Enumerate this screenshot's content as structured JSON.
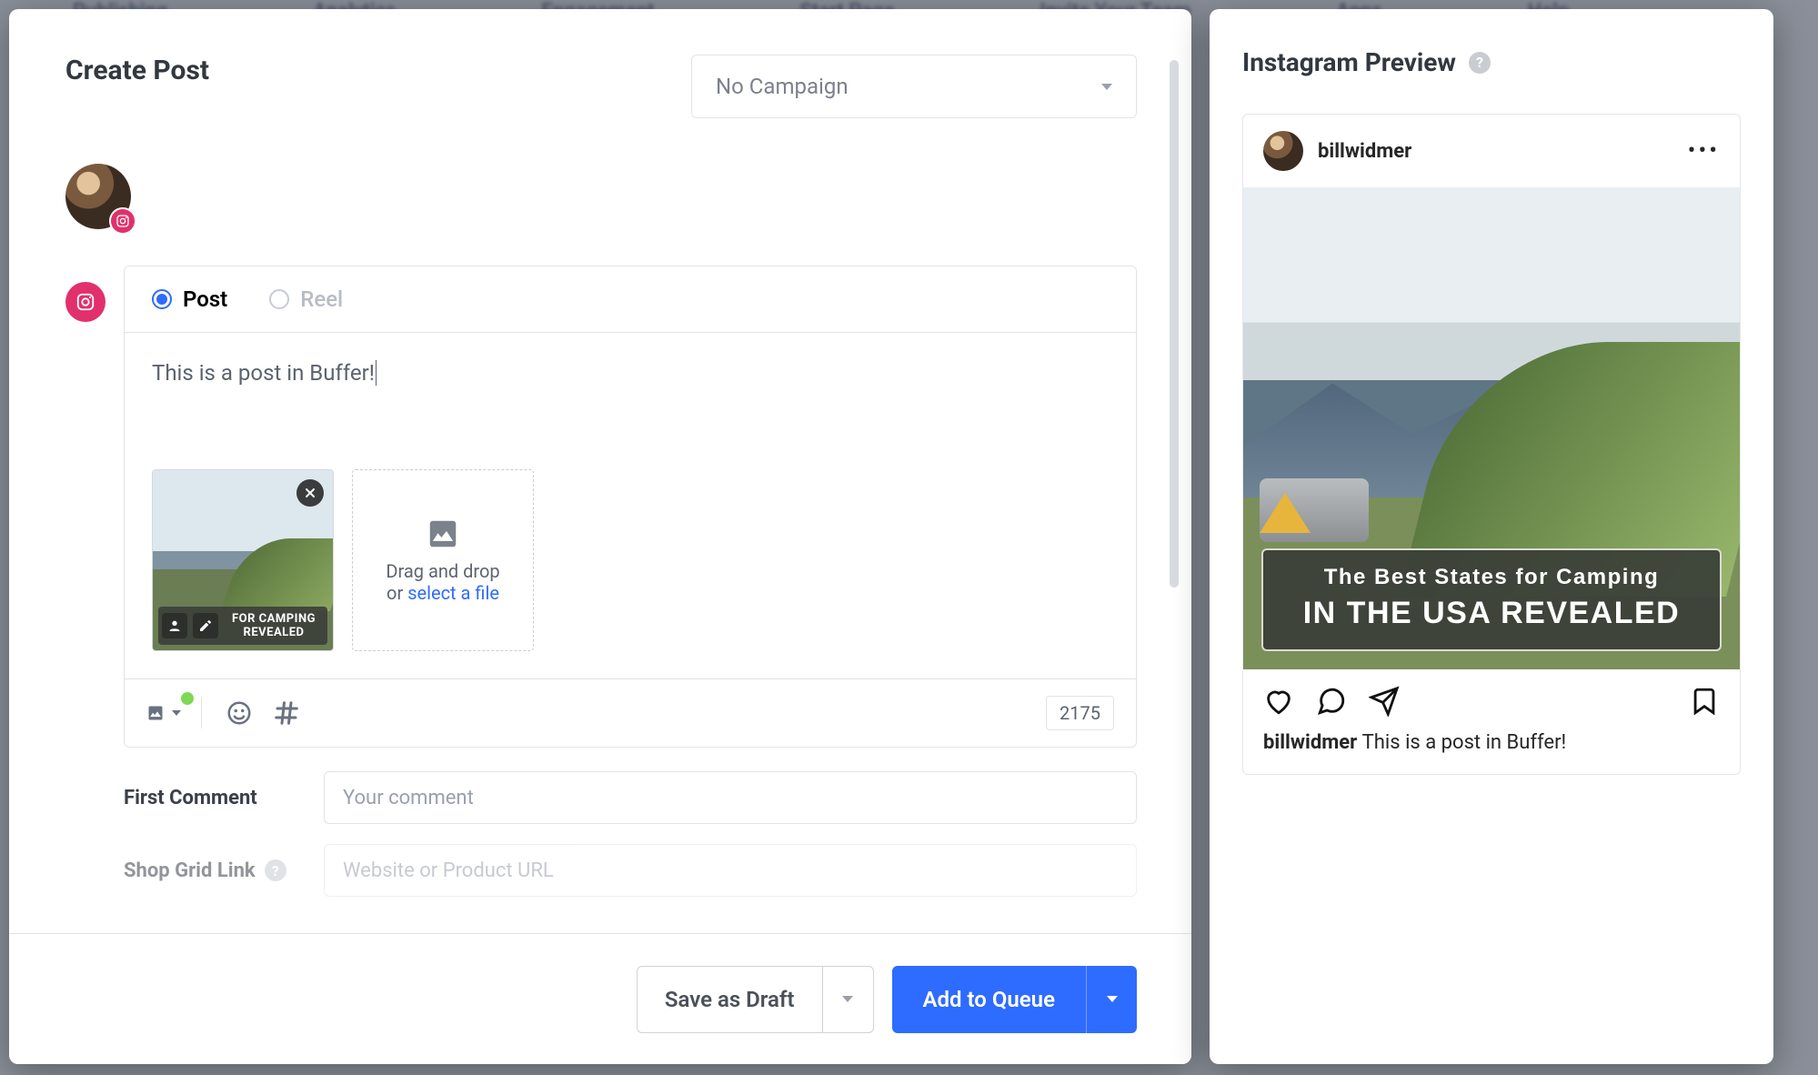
{
  "bg_nav": [
    "Publishing",
    "Analytics",
    "Engagement",
    "Start Page",
    "Invite Your Team",
    "Apps",
    "Help"
  ],
  "modal": {
    "title": "Create Post",
    "campaign": {
      "value": "No Campaign"
    },
    "tabs": {
      "post": "Post",
      "reel": "Reel",
      "selected": "post"
    },
    "text": "This is a post in Buffer!",
    "dropzone": {
      "line1": "Drag and drop",
      "line2_prefix": "or ",
      "link": "select a file"
    },
    "thumb_banner_text": "FOR CAMPING REVEALED",
    "char_count": "2175",
    "first_comment": {
      "label": "First Comment",
      "placeholder": "Your comment"
    },
    "shop_grid": {
      "label": "Shop Grid Link",
      "placeholder": "Website or Product URL"
    },
    "footer": {
      "draft": "Save as Draft",
      "queue": "Add to Queue"
    }
  },
  "preview": {
    "title": "Instagram Preview",
    "username": "billwidmer",
    "image_banner_line1": "The Best States for Camping",
    "image_banner_line2": "IN THE USA REVEALED",
    "caption_user": "billwidmer",
    "caption_text": "This is a post in Buffer!"
  }
}
